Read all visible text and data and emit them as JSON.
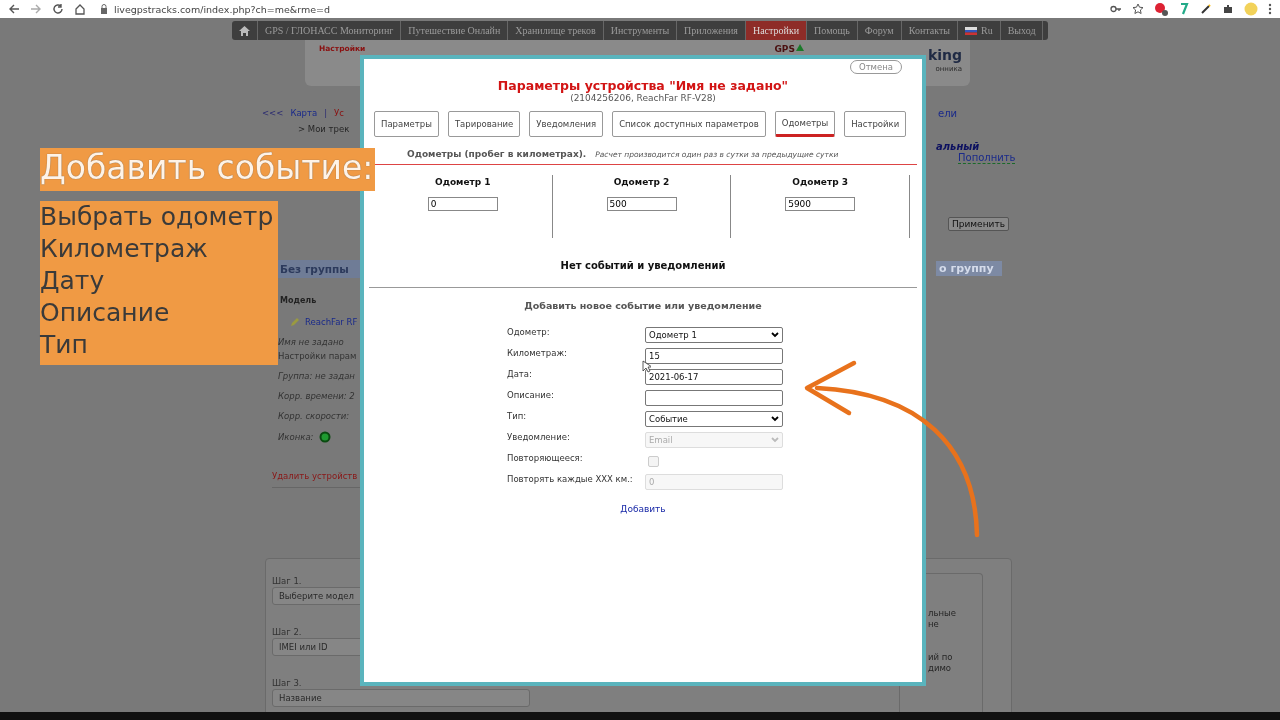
{
  "browser": {
    "url": "livegpstracks.com/index.php?ch=me&rme=d"
  },
  "nav": {
    "items": [
      {
        "kind": "home",
        "selected": false
      },
      {
        "kind": "text",
        "label": "GPS / ГЛОНАСС Мониторинг",
        "selected": false
      },
      {
        "kind": "text",
        "label": "Путешествие Онлайн",
        "selected": false
      },
      {
        "kind": "text",
        "label": "Хранилище треков",
        "selected": false
      },
      {
        "kind": "text",
        "label": "Инструменты",
        "selected": false
      },
      {
        "kind": "text",
        "label": "Приложения",
        "selected": false
      },
      {
        "kind": "text",
        "label": "Настройки",
        "selected": true
      },
      {
        "kind": "text",
        "label": "Помощь",
        "selected": false
      },
      {
        "kind": "text",
        "label": "Форум",
        "selected": false
      },
      {
        "kind": "text",
        "label": "Контакты",
        "selected": false
      },
      {
        "kind": "flag",
        "label": "Ru",
        "selected": false
      },
      {
        "kind": "text",
        "label": "Выход",
        "selected": false
      }
    ]
  },
  "header": {
    "section": "Настройки",
    "gps": "GPS",
    "brand": "king",
    "tagline": "онника"
  },
  "left_panel": {
    "breadcrumb": [
      {
        "kind": "muted",
        "text": "<<<"
      },
      {
        "kind": "link",
        "text": "Карта"
      },
      {
        "kind": "muted",
        "text": "|"
      },
      {
        "kind": "alert",
        "text": "Ус"
      }
    ],
    "path": "> Мои трек",
    "group": "Без группы",
    "column": "Модель",
    "device": "ReachFar RF",
    "lines": [
      {
        "text": "Имя не задано",
        "italic": true
      },
      {
        "text": "Настройки парам",
        "italic": false
      },
      {
        "text": "Группа: не задан",
        "italic": true
      },
      {
        "text": "Корр. времени: 2",
        "italic": true
      },
      {
        "text": "Корр. скорости: ",
        "italic": true
      }
    ],
    "icon_label": "Иконка:",
    "delete": "Удалить устройств"
  },
  "right_panel": {
    "link": "ели",
    "tariff": "альный",
    "topup": "Пополнить",
    "apply": "Применить",
    "group_bar": "о группу",
    "notes": [
      "льные",
      "не",
      "ий по",
      "димо"
    ]
  },
  "steps": [
    {
      "label": "Шаг 1.",
      "placeholder": "Выберите модел",
      "kind": "select"
    },
    {
      "label": "Шаг 2.",
      "placeholder": "IMEI или ID",
      "kind": "input"
    },
    {
      "label": "Шаг 3.",
      "placeholder": "Название",
      "kind": "input"
    }
  ],
  "modal": {
    "cancel": "Отмена",
    "title": "Параметры устройства \"Имя не задано\"",
    "subtitle": "(2104256206, ReachFar RF-V28)",
    "tabs": [
      {
        "label": "Параметры",
        "selected": false
      },
      {
        "label": "Тарирование",
        "selected": false
      },
      {
        "label": "Уведомления",
        "selected": false
      },
      {
        "label": "Список доступных параметров",
        "selected": false
      },
      {
        "label": "Одометры",
        "selected": true
      },
      {
        "label": "Настройки",
        "selected": false
      }
    ],
    "heading": "Одометры (пробег в километрах).",
    "note": "Расчет производится один раз в сутки за предыдущие сутки",
    "odometers": [
      {
        "label": "Одометр 1",
        "value": "0"
      },
      {
        "label": "Одометр 2",
        "value": "500"
      },
      {
        "label": "Одометр 3",
        "value": "5900"
      }
    ],
    "empty": "Нет событий и уведомлений",
    "form_title": "Добавить новое событие или уведомление",
    "form": [
      {
        "label": "Одометр:",
        "kind": "select",
        "value": "Одометр 1",
        "disabled": false
      },
      {
        "label": "Километраж:",
        "kind": "input",
        "value": "15",
        "disabled": false
      },
      {
        "label": "Дата:",
        "kind": "input",
        "value": "2021-06-17",
        "disabled": false
      },
      {
        "label": "Описание:",
        "kind": "input",
        "disabled": false
      },
      {
        "label": "Тип:",
        "kind": "select",
        "value": "Событие",
        "disabled": false
      },
      {
        "label": "Уведомление:",
        "kind": "select",
        "value": "Email",
        "disabled": true
      },
      {
        "label": "Повторяющееся:",
        "kind": "checkbox",
        "checked": false,
        "disabled": true
      },
      {
        "label": "Повторять каждые XXX км.:",
        "kind": "input",
        "value": "0",
        "disabled": true
      }
    ],
    "add": "Добавить"
  },
  "callout": {
    "title": "Добавить событие:",
    "items": [
      "Выбрать одометр",
      "Километраж",
      "Дату",
      "Описание",
      "Тип"
    ]
  }
}
